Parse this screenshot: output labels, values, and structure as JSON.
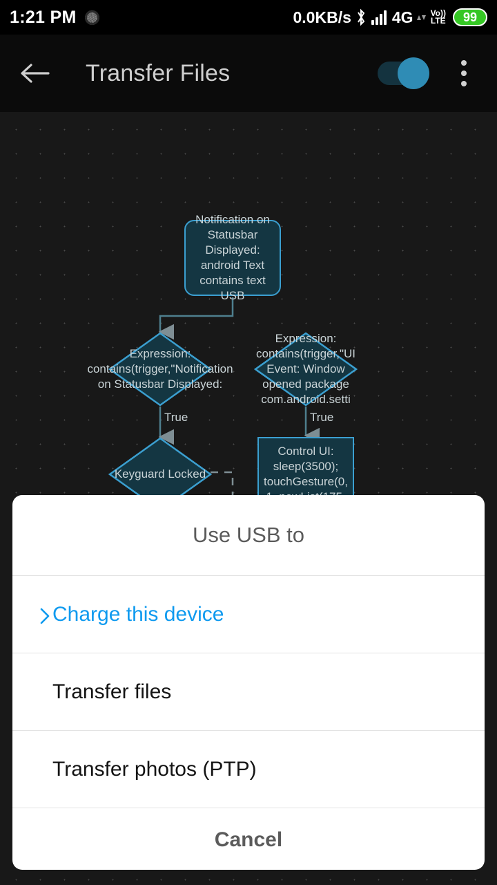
{
  "statusbar": {
    "time": "1:21 PM",
    "spinner_icon": "loading-spinner-icon",
    "network_speed": "0.0KB/s",
    "bluetooth_icon": "bluetooth-icon",
    "signal_icon": "signal-bars-icon",
    "network_type": "4G",
    "data_arrows_icon": "data-transfer-arrows-icon",
    "volte_line1": "Vo))",
    "volte_line2": "LTE",
    "battery_level": "99"
  },
  "appbar": {
    "back_icon": "back-arrow-icon",
    "title": "Transfer Files",
    "toggle_state": "on",
    "overflow_icon": "overflow-menu-icon"
  },
  "canvas": {
    "background_color": "#181818",
    "node_fill": "#143642",
    "node_border": "#3b9fd0",
    "connector_color": "#4e7f8e",
    "nodes": [
      {
        "id": "trigger-notification",
        "shape": "rounded-rect",
        "text": "Notification on Statusbar Displayed: android Text contains text USB"
      },
      {
        "id": "expression-notification",
        "shape": "diamond",
        "text": "Expression: contains(trigger,\"Notification on Statusbar Displayed:"
      },
      {
        "id": "expression-uievent",
        "shape": "diamond",
        "text": "Expression: contains(trigger,\"UI Event: Window opened package com.android.setti"
      },
      {
        "id": "keyguard-locked",
        "shape": "diamond",
        "text": "Keyguard Locked"
      },
      {
        "id": "control-ui",
        "shape": "rect",
        "text": "Control UI: sleep(3500); touchGesture(0, 1, newList(175,"
      }
    ],
    "edge_labels": [
      "True",
      "True"
    ]
  },
  "dialog": {
    "title": "Use USB to",
    "options": [
      {
        "label": "Charge this device",
        "selected": true,
        "chevron_icon": "chevron-right-icon"
      },
      {
        "label": "Transfer files",
        "selected": false
      },
      {
        "label": "Transfer photos (PTP)",
        "selected": false
      }
    ],
    "cancel_label": "Cancel",
    "accent_color": "#0f9aef"
  }
}
